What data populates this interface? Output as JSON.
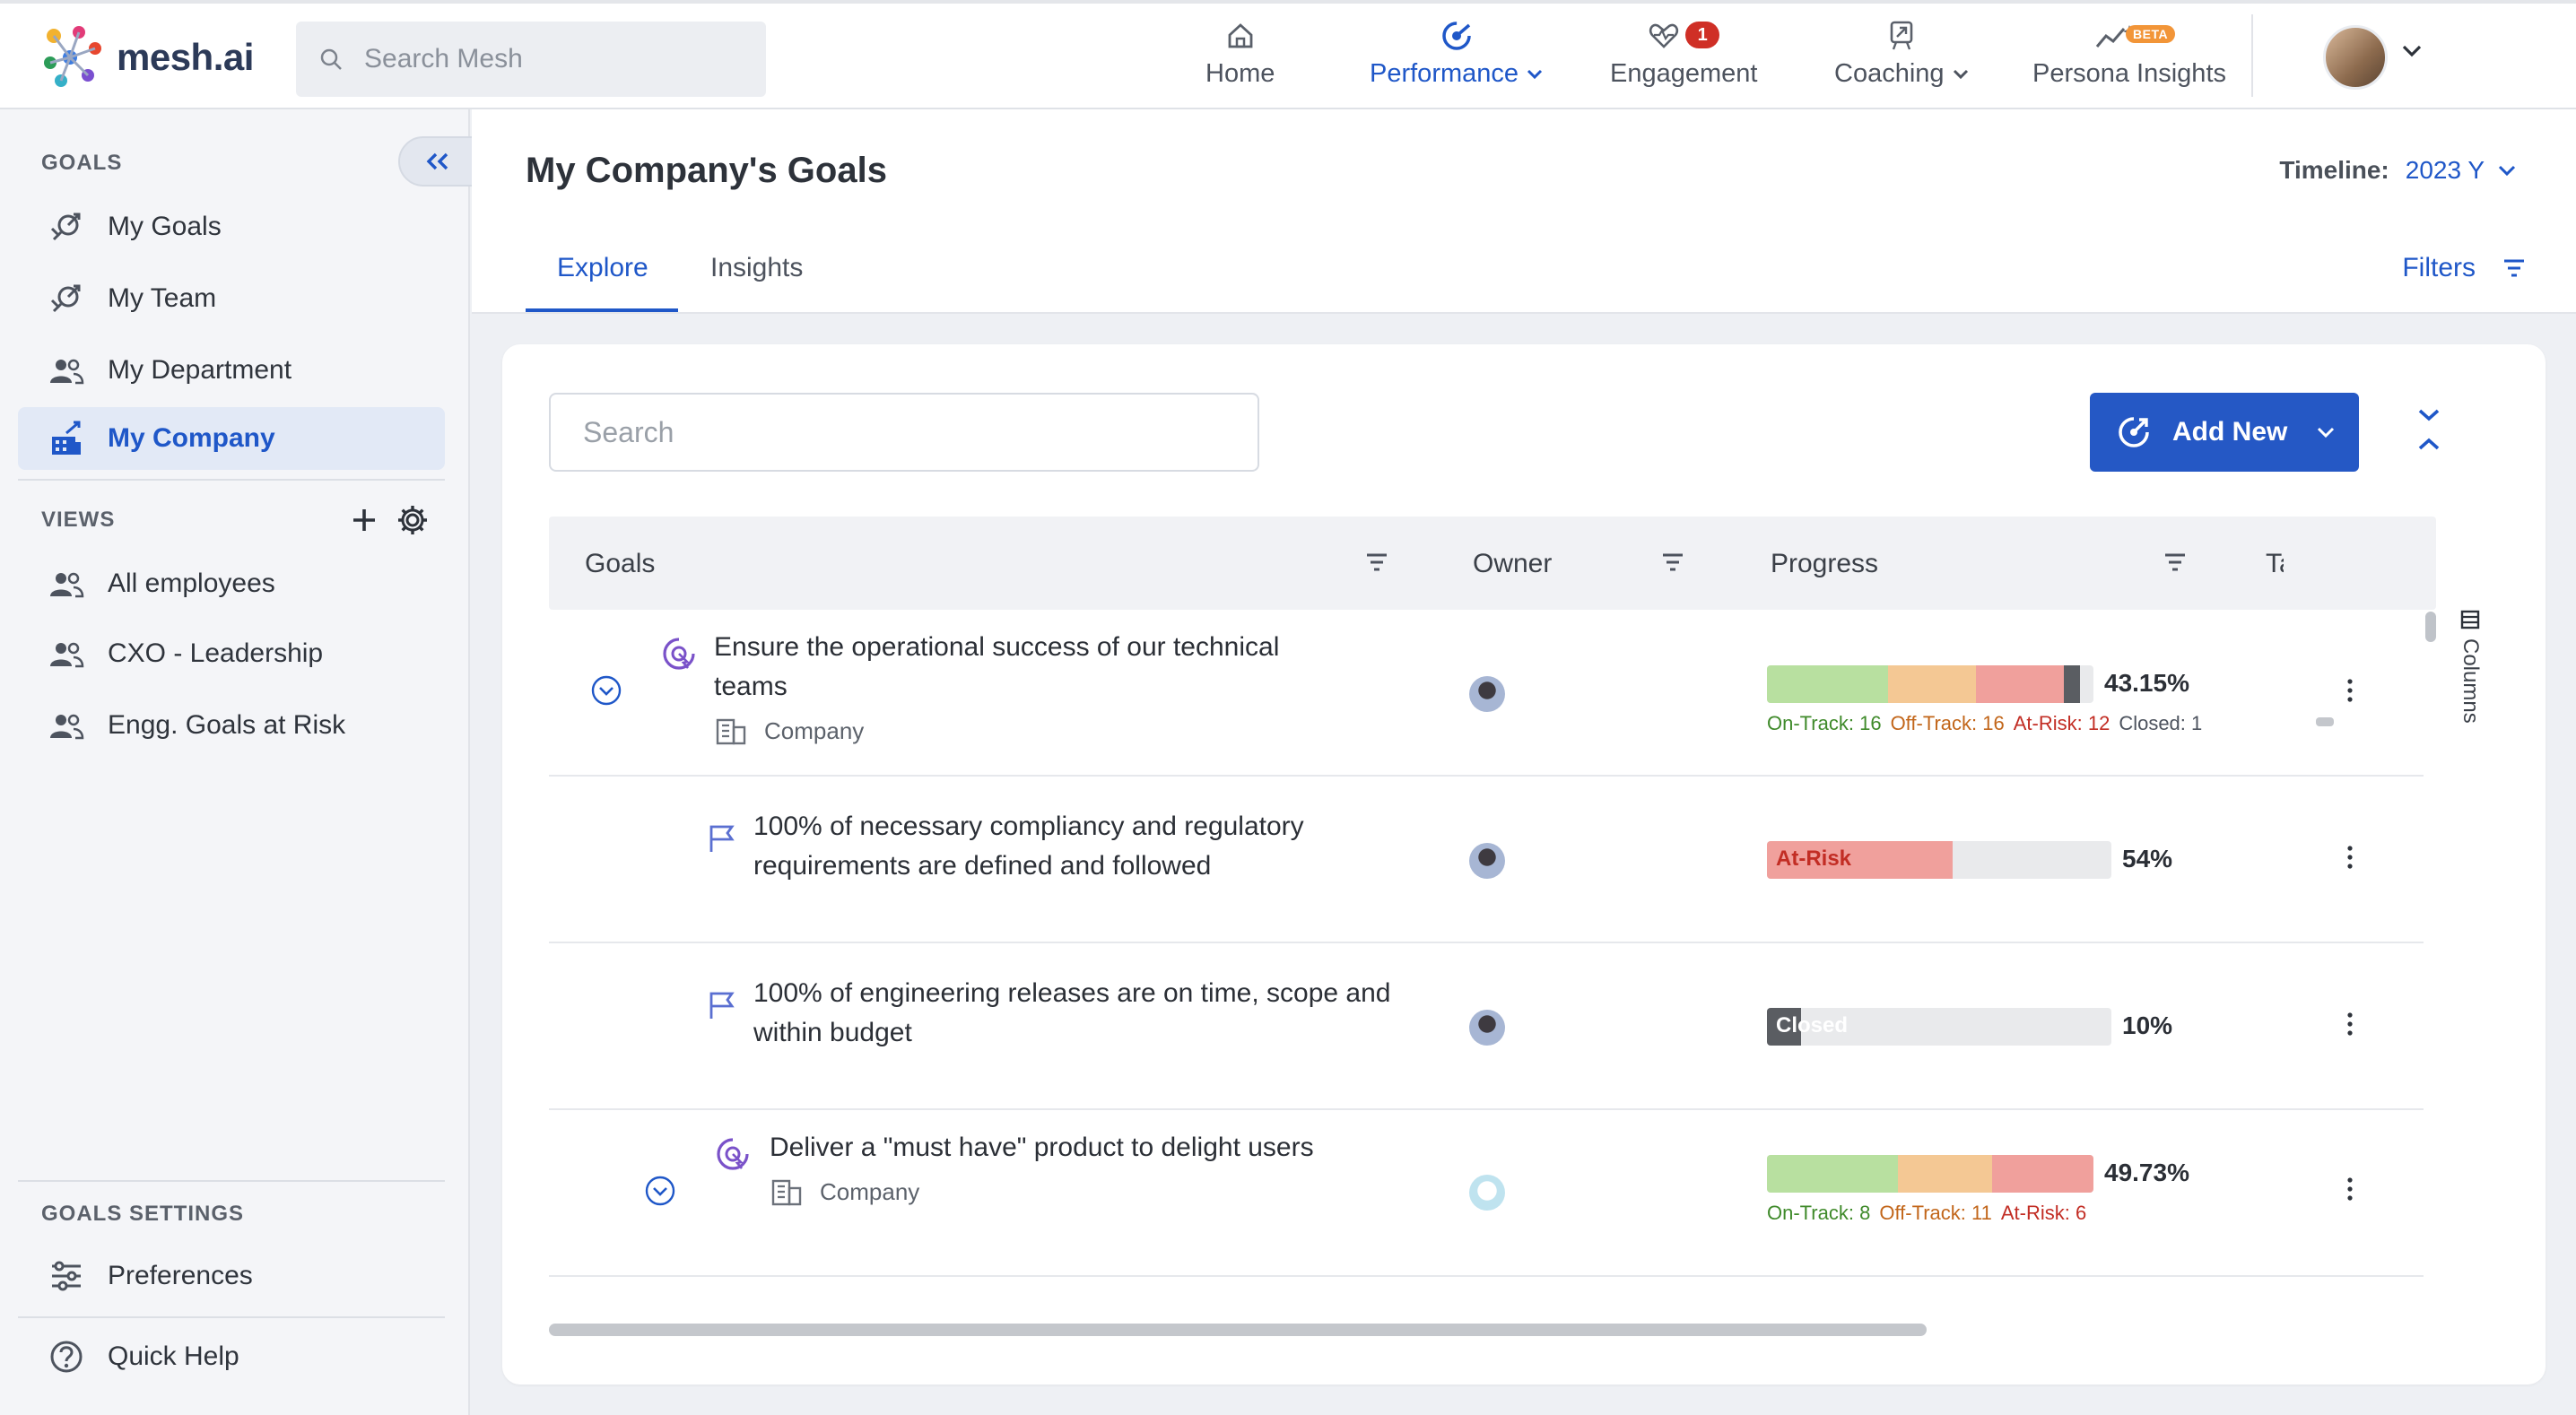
{
  "app": {
    "name": "mesh.ai"
  },
  "topbar": {
    "search_placeholder": "Search Mesh",
    "nav": [
      {
        "label": "Home",
        "icon": "home-icon"
      },
      {
        "label": "Performance",
        "icon": "performance-icon",
        "active": true
      },
      {
        "label": "Engagement",
        "icon": "heart-pulse-icon",
        "badge": "1"
      },
      {
        "label": "Coaching",
        "icon": "coaching-icon"
      },
      {
        "label": "Persona Insights",
        "icon": "sparkle-trend-icon",
        "badge": "BETA"
      }
    ]
  },
  "sidebar": {
    "goals_title": "GOALS",
    "goals_items": [
      {
        "label": "My Goals"
      },
      {
        "label": "My Team"
      },
      {
        "label": "My Department"
      },
      {
        "label": "My Company",
        "active": true
      }
    ],
    "views_title": "VIEWS",
    "views_items": [
      {
        "label": "All employees"
      },
      {
        "label": "CXO - Leadership"
      },
      {
        "label": "Engg. Goals at Risk"
      }
    ],
    "settings_title": "GOALS SETTINGS",
    "preferences": "Preferences",
    "quick_help": "Quick Help"
  },
  "header": {
    "title": "My Company's Goals",
    "timeline_label": "Timeline:",
    "timeline_value": "2023 Y",
    "tabs": [
      "Explore",
      "Insights"
    ],
    "filters": "Filters"
  },
  "toolbar": {
    "search_placeholder": "Search",
    "add_new": "Add New"
  },
  "table": {
    "columns": [
      "Goals",
      "Owner",
      "Progress",
      "Ta"
    ],
    "columns_toggle": "Columns",
    "rows": [
      {
        "title_line1": "Ensure the operational success of our technical",
        "title_line2": "teams",
        "scope": "Company",
        "percent": "43.15%",
        "legend": {
          "on_track": "On-Track: 16",
          "off_track": "Off-Track: 16",
          "at_risk": "At-Risk: 12",
          "closed": "Closed: 1"
        },
        "segments": [
          0.37,
          0.27,
          0.27,
          0.05
        ]
      },
      {
        "title_line1": "100% of necessary compliancy and regulatory",
        "title_line2": "requirements are defined and followed",
        "status": "At-Risk",
        "percent": "54%",
        "progress": 0.54
      },
      {
        "title_line1": "100% of engineering releases are on time, scope and",
        "title_line2": "within budget",
        "status": "Closed",
        "percent": "10%",
        "progress": 0.1
      },
      {
        "title_line1": "Deliver a \"must have\" product to delight users",
        "scope": "Company",
        "percent": "49.73%",
        "legend": {
          "on_track": "On-Track: 8",
          "off_track": "Off-Track: 11",
          "at_risk": "At-Risk: 6"
        },
        "segments": [
          0.4,
          0.29,
          0.31
        ]
      }
    ]
  },
  "colors": {
    "accent": "#1f57c8",
    "on_track": "#b8e0a0",
    "off_track": "#f4c894",
    "at_risk": "#f0a09c",
    "closed": "#5a5d62",
    "on_track_text": "#3f8a2a",
    "off_track_text": "#c2661a",
    "at_risk_text": "#c22d24"
  }
}
